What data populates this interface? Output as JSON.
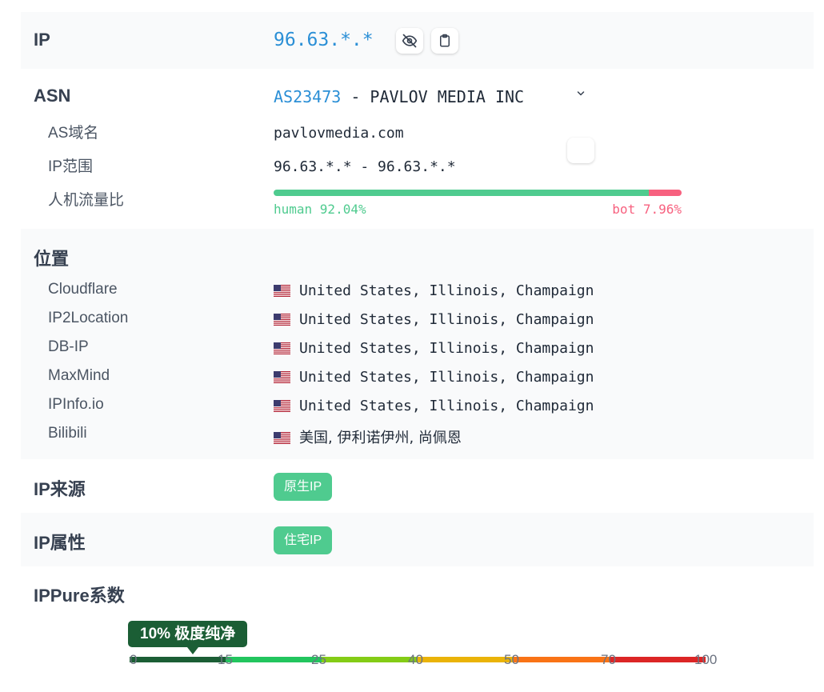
{
  "ip": {
    "label": "IP",
    "value": "96.63.*.*",
    "hide_icon": "eye-slash-icon",
    "copy_icon": "clipboard-icon"
  },
  "asn": {
    "label": "ASN",
    "number": "AS23473",
    "separator": " - ",
    "org": "PAVLOV MEDIA INC",
    "expand_icon": "chevron-down-icon",
    "domain_label": "AS域名",
    "domain_value": "pavlovmedia.com",
    "range_label": "IP范围",
    "range_value": "96.63.*.* - 96.63.*.*",
    "traffic_label": "人机流量比",
    "human_text": "human 92.04%",
    "bot_text": "bot 7.96%",
    "human_pct": 92.04,
    "bot_pct": 7.96,
    "human_color": "#4fcb8f",
    "bot_color": "#f7617f"
  },
  "location": {
    "label": "位置",
    "flag_icon": "us-flag-icon",
    "rows": [
      {
        "source": "Cloudflare",
        "value": "United States, Illinois, Champaign"
      },
      {
        "source": "IP2Location",
        "value": "United States, Illinois, Champaign"
      },
      {
        "source": "DB-IP",
        "value": "United States, Illinois, Champaign"
      },
      {
        "source": "MaxMind",
        "value": "United States, Illinois, Champaign"
      },
      {
        "source": "IPInfo.io",
        "value": "United States, Illinois, Champaign"
      },
      {
        "source": "Bilibili",
        "value": "美国, 伊利诺伊州, 尚佩恩"
      }
    ]
  },
  "source": {
    "label": "IP来源",
    "badge": "原生IP"
  },
  "attribute": {
    "label": "IP属性",
    "badge": "住宅IP"
  },
  "ippure": {
    "label": "IPPure系数",
    "score_tooltip": "10% 极度纯净",
    "score_pct": 10,
    "scale_ticks": [
      "0",
      "15",
      "25",
      "40",
      "50",
      "70",
      "100"
    ],
    "scale_colors": [
      "#1b5e35",
      "#22c55e",
      "#84cc16",
      "#eab308",
      "#f97316",
      "#dc2626"
    ],
    "badge_color": "#4fcb8f",
    "link_color": "#2b8fd6"
  }
}
